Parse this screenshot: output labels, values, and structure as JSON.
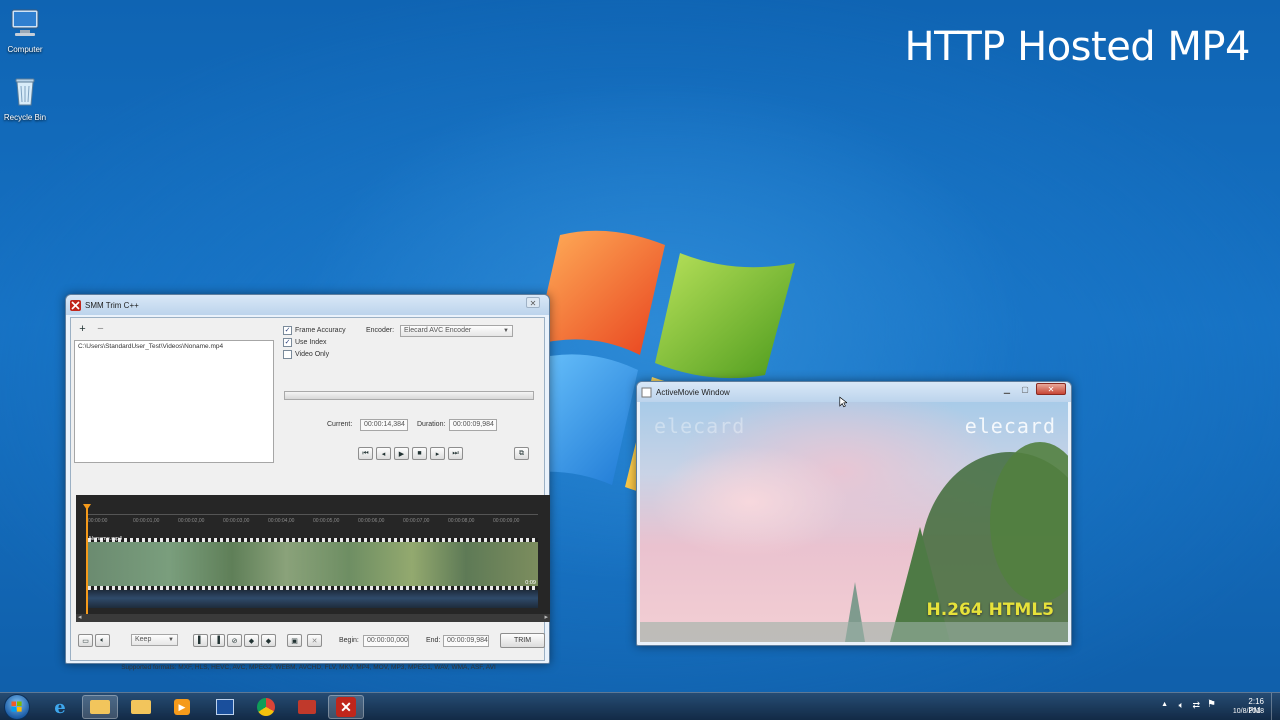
{
  "overlay": {
    "title": "HTTP Hosted MP4"
  },
  "desktop": {
    "icons": [
      {
        "label": "Computer"
      },
      {
        "label": "Recycle Bin"
      }
    ]
  },
  "smm_window": {
    "title": "SMM Trim C++",
    "add_label": "+",
    "remove_label": "−",
    "file_list": [
      "C:\\Users\\StandardUser_Test\\Videos\\Noname.mp4"
    ],
    "options": {
      "frame_accuracy": {
        "label": "Frame Accuracy",
        "checked": true
      },
      "use_index": {
        "label": "Use Index",
        "checked": true
      },
      "video_only": {
        "label": "Video Only",
        "checked": false
      }
    },
    "encoder": {
      "label": "Encoder:",
      "value": "Elecard AVC Encoder"
    },
    "current": {
      "label": "Current:",
      "value": "00:00:14,384"
    },
    "duration": {
      "label": "Duration:",
      "value": "00:00:09,984"
    },
    "timeline": {
      "ticks": [
        "00:00:00",
        "00:00:01,00",
        "00:00:02,00",
        "00:00:03,00",
        "00:00:04,00",
        "00:00:05,00",
        "00:00:06,00",
        "00:00:07,00",
        "00:00:08,00",
        "00:00:09,00"
      ],
      "clip_name": "Noname.mp4",
      "clip_end_label": "0:09"
    },
    "keep_select": {
      "value": "Keep"
    },
    "begin": {
      "label": "Begin:",
      "value": "00:00:00,000"
    },
    "end": {
      "label": "End:",
      "value": "00:00:09,984"
    },
    "trim_label": "TRIM",
    "supported_formats": "Supported formats: MXF, HLS, HEVC, AVC, MPEG2, WEBM, AVCHD, FLV, MKV, MP4, MOV, MP3, MPEG1, WAV, WMA, ASF, AVI"
  },
  "activemovie": {
    "title": "ActiveMovie Window",
    "logo_left": "elecard",
    "logo_right": "elecard",
    "caption": "H.264 HTML5"
  },
  "tray": {
    "time": "2:16 PM",
    "date": "10/8/2018"
  },
  "colors": {
    "accent_orange": "#f59a1b",
    "caption_yellow": "#e6e23a"
  }
}
